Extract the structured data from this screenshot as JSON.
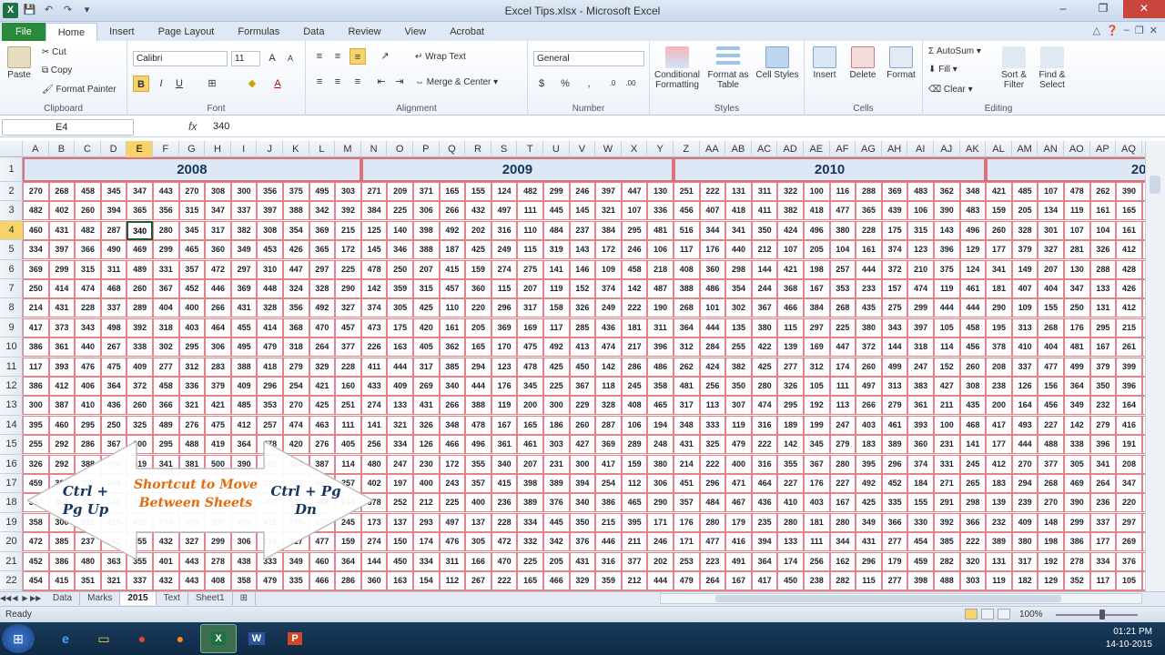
{
  "window": {
    "title": "Excel Tips.xlsx - Microsoft Excel",
    "minimize": "–",
    "restore": "❐",
    "close": "✕"
  },
  "tabs": [
    "File",
    "Home",
    "Insert",
    "Page Layout",
    "Formulas",
    "Data",
    "Review",
    "View",
    "Acrobat"
  ],
  "ribbon": {
    "clipboard": {
      "label": "Clipboard",
      "paste": "Paste",
      "cut": "Cut",
      "copy": "Copy",
      "format_painter": "Format Painter"
    },
    "font": {
      "label": "Font",
      "family": "Calibri",
      "size": "11",
      "bold": "B",
      "italic": "I",
      "underline": "U"
    },
    "alignment": {
      "label": "Alignment",
      "wrap": "Wrap Text",
      "merge": "Merge & Center"
    },
    "number": {
      "label": "Number",
      "format": "General",
      "percent": "%"
    },
    "styles": {
      "label": "Styles",
      "conditional": "Conditional Formatting",
      "format_table": "Format as Table",
      "cell_styles": "Cell Styles"
    },
    "cells": {
      "label": "Cells",
      "insert": "Insert",
      "delete": "Delete",
      "format": "Format"
    },
    "editing": {
      "label": "Editing",
      "autosum": "AutoSum",
      "fill": "Fill",
      "clear": "Clear",
      "sort": "Sort & Filter",
      "find": "Find & Select"
    }
  },
  "formula": {
    "name_box": "E4",
    "fx": "fx",
    "value": "340"
  },
  "columns": [
    "A",
    "B",
    "C",
    "D",
    "E",
    "F",
    "G",
    "H",
    "I",
    "J",
    "K",
    "L",
    "M",
    "N",
    "O",
    "P",
    "Q",
    "R",
    "S",
    "T",
    "U",
    "V",
    "W",
    "X",
    "Y",
    "Z",
    "AA",
    "AB",
    "AC",
    "AD",
    "AE",
    "AF",
    "AG",
    "AH",
    "AI",
    "AJ",
    "AK",
    "AL",
    "AM",
    "AN",
    "AO",
    "AP",
    "AQ",
    "AR"
  ],
  "rows": [
    "1",
    "2",
    "3",
    "4",
    "5",
    "6",
    "7",
    "8",
    "9",
    "10",
    "11",
    "12",
    "13",
    "14",
    "15",
    "16",
    "17",
    "18",
    "19",
    "20",
    "21",
    "22",
    "23"
  ],
  "years": [
    "2008",
    "2009",
    "2010",
    "2011"
  ],
  "table_rows": [
    [
      "270",
      "268",
      "458",
      "345",
      "347",
      "443",
      "270",
      "308",
      "300",
      "356",
      "375",
      "495",
      "303",
      "271",
      "209",
      "371",
      "165",
      "155",
      "124",
      "482",
      "299",
      "246",
      "397",
      "447",
      "130",
      "251",
      "222",
      "131",
      "311",
      "322",
      "100",
      "116",
      "288",
      "369",
      "483",
      "362",
      "348",
      "421",
      "485",
      "107",
      "478",
      "262",
      "390",
      "298"
    ],
    [
      "482",
      "402",
      "260",
      "394",
      "365",
      "356",
      "315",
      "347",
      "337",
      "397",
      "388",
      "342",
      "392",
      "384",
      "225",
      "306",
      "266",
      "432",
      "497",
      "111",
      "445",
      "145",
      "321",
      "107",
      "336",
      "456",
      "407",
      "418",
      "411",
      "382",
      "418",
      "477",
      "365",
      "439",
      "106",
      "390",
      "483",
      "159",
      "205",
      "134",
      "119",
      "161",
      "165",
      "348"
    ],
    [
      "460",
      "431",
      "482",
      "287",
      "340",
      "280",
      "345",
      "317",
      "382",
      "308",
      "354",
      "369",
      "215",
      "125",
      "140",
      "398",
      "492",
      "202",
      "316",
      "110",
      "484",
      "237",
      "384",
      "295",
      "481",
      "516",
      "344",
      "341",
      "350",
      "424",
      "496",
      "380",
      "228",
      "175",
      "315",
      "143",
      "496",
      "260",
      "328",
      "301",
      "107",
      "104",
      "161",
      "166"
    ],
    [
      "334",
      "397",
      "366",
      "490",
      "469",
      "299",
      "465",
      "360",
      "349",
      "453",
      "426",
      "365",
      "172",
      "145",
      "346",
      "388",
      "187",
      "425",
      "249",
      "115",
      "319",
      "143",
      "172",
      "246",
      "106",
      "117",
      "176",
      "440",
      "212",
      "107",
      "205",
      "104",
      "161",
      "374",
      "123",
      "396",
      "129",
      "177",
      "379",
      "327",
      "281",
      "326",
      "412",
      "162"
    ],
    [
      "369",
      "299",
      "315",
      "311",
      "489",
      "331",
      "357",
      "472",
      "297",
      "310",
      "447",
      "297",
      "225",
      "478",
      "250",
      "207",
      "415",
      "159",
      "274",
      "275",
      "141",
      "146",
      "109",
      "458",
      "218",
      "408",
      "360",
      "298",
      "144",
      "421",
      "198",
      "257",
      "444",
      "372",
      "210",
      "375",
      "124",
      "341",
      "149",
      "207",
      "130",
      "288",
      "428",
      "296"
    ],
    [
      "250",
      "414",
      "474",
      "468",
      "260",
      "367",
      "452",
      "446",
      "369",
      "448",
      "324",
      "328",
      "290",
      "142",
      "359",
      "315",
      "457",
      "360",
      "115",
      "207",
      "119",
      "152",
      "374",
      "142",
      "487",
      "388",
      "486",
      "354",
      "244",
      "368",
      "167",
      "353",
      "233",
      "157",
      "474",
      "119",
      "461",
      "181",
      "407",
      "404",
      "347",
      "133",
      "426",
      "104"
    ],
    [
      "214",
      "431",
      "228",
      "337",
      "289",
      "404",
      "400",
      "266",
      "431",
      "328",
      "356",
      "492",
      "327",
      "374",
      "305",
      "425",
      "110",
      "220",
      "296",
      "317",
      "158",
      "326",
      "249",
      "222",
      "190",
      "268",
      "101",
      "302",
      "367",
      "466",
      "384",
      "268",
      "435",
      "275",
      "299",
      "444",
      "444",
      "290",
      "109",
      "155",
      "250",
      "131",
      "412",
      "365"
    ],
    [
      "417",
      "373",
      "343",
      "498",
      "392",
      "318",
      "403",
      "464",
      "455",
      "414",
      "368",
      "470",
      "457",
      "473",
      "175",
      "420",
      "161",
      "205",
      "369",
      "169",
      "117",
      "285",
      "436",
      "181",
      "311",
      "364",
      "444",
      "135",
      "380",
      "115",
      "297",
      "225",
      "380",
      "343",
      "397",
      "105",
      "458",
      "195",
      "313",
      "268",
      "176",
      "295",
      "215",
      "249"
    ],
    [
      "386",
      "361",
      "440",
      "267",
      "338",
      "302",
      "295",
      "306",
      "495",
      "479",
      "318",
      "264",
      "377",
      "226",
      "163",
      "405",
      "362",
      "165",
      "170",
      "475",
      "492",
      "413",
      "474",
      "217",
      "396",
      "312",
      "284",
      "255",
      "422",
      "139",
      "169",
      "447",
      "372",
      "144",
      "318",
      "114",
      "456",
      "378",
      "410",
      "404",
      "481",
      "167",
      "261",
      "156"
    ],
    [
      "117",
      "393",
      "476",
      "475",
      "409",
      "277",
      "312",
      "283",
      "388",
      "418",
      "279",
      "329",
      "228",
      "411",
      "444",
      "317",
      "385",
      "294",
      "123",
      "478",
      "425",
      "450",
      "142",
      "286",
      "486",
      "262",
      "424",
      "382",
      "425",
      "277",
      "312",
      "174",
      "260",
      "499",
      "247",
      "152",
      "260",
      "208",
      "337",
      "477",
      "499",
      "379",
      "399",
      "464"
    ],
    [
      "386",
      "412",
      "406",
      "364",
      "372",
      "458",
      "336",
      "379",
      "409",
      "296",
      "254",
      "421",
      "160",
      "433",
      "409",
      "269",
      "340",
      "444",
      "176",
      "345",
      "225",
      "367",
      "118",
      "245",
      "358",
      "481",
      "256",
      "350",
      "280",
      "326",
      "105",
      "111",
      "497",
      "313",
      "383",
      "427",
      "308",
      "238",
      "126",
      "156",
      "364",
      "350",
      "396",
      "260"
    ],
    [
      "300",
      "387",
      "410",
      "436",
      "260",
      "366",
      "321",
      "421",
      "485",
      "353",
      "270",
      "425",
      "251",
      "274",
      "133",
      "431",
      "266",
      "388",
      "119",
      "200",
      "300",
      "229",
      "328",
      "408",
      "465",
      "317",
      "113",
      "307",
      "474",
      "295",
      "192",
      "113",
      "266",
      "279",
      "361",
      "211",
      "435",
      "200",
      "164",
      "456",
      "349",
      "232",
      "164",
      "372"
    ],
    [
      "395",
      "460",
      "295",
      "250",
      "325",
      "489",
      "276",
      "475",
      "412",
      "257",
      "474",
      "463",
      "111",
      "141",
      "321",
      "326",
      "348",
      "478",
      "167",
      "165",
      "186",
      "260",
      "287",
      "106",
      "194",
      "348",
      "333",
      "119",
      "316",
      "189",
      "199",
      "247",
      "403",
      "461",
      "393",
      "100",
      "468",
      "417",
      "493",
      "227",
      "142",
      "279",
      "416",
      "274"
    ],
    [
      "255",
      "292",
      "286",
      "367",
      "100",
      "295",
      "488",
      "419",
      "364",
      "478",
      "420",
      "276",
      "405",
      "256",
      "334",
      "126",
      "466",
      "496",
      "361",
      "461",
      "303",
      "427",
      "369",
      "289",
      "248",
      "431",
      "325",
      "479",
      "222",
      "142",
      "345",
      "279",
      "183",
      "389",
      "360",
      "231",
      "141",
      "177",
      "444",
      "488",
      "338",
      "396",
      "191",
      "108"
    ],
    [
      "326",
      "292",
      "388",
      "400",
      "419",
      "341",
      "381",
      "500",
      "390",
      "365",
      "384",
      "387",
      "114",
      "480",
      "247",
      "230",
      "172",
      "355",
      "340",
      "207",
      "231",
      "300",
      "417",
      "159",
      "380",
      "214",
      "222",
      "400",
      "316",
      "355",
      "367",
      "280",
      "395",
      "296",
      "374",
      "331",
      "245",
      "412",
      "270",
      "377",
      "305",
      "341",
      "208",
      "277"
    ],
    [
      "459",
      "300",
      "327",
      "264",
      "281",
      "460",
      "301",
      "292",
      "490",
      "370",
      "301",
      "447",
      "257",
      "402",
      "197",
      "400",
      "243",
      "357",
      "415",
      "398",
      "389",
      "394",
      "254",
      "112",
      "306",
      "451",
      "296",
      "471",
      "464",
      "227",
      "176",
      "227",
      "492",
      "452",
      "184",
      "271",
      "265",
      "183",
      "294",
      "268",
      "469",
      "264",
      "347",
      "175"
    ],
    [
      "360",
      "301",
      "323",
      "349",
      "399",
      "394",
      "387",
      "344",
      "403",
      "400",
      "379",
      "466",
      "244",
      "378",
      "252",
      "212",
      "225",
      "400",
      "236",
      "389",
      "376",
      "340",
      "386",
      "465",
      "290",
      "357",
      "484",
      "467",
      "436",
      "410",
      "403",
      "167",
      "425",
      "335",
      "155",
      "291",
      "298",
      "139",
      "239",
      "270",
      "390",
      "236",
      "220",
      "411"
    ],
    [
      "358",
      "300",
      "311",
      "415",
      "425",
      "473",
      "350",
      "305",
      "499",
      "411",
      "375",
      "372",
      "245",
      "173",
      "137",
      "293",
      "497",
      "137",
      "228",
      "334",
      "445",
      "350",
      "215",
      "395",
      "171",
      "176",
      "280",
      "179",
      "235",
      "280",
      "181",
      "280",
      "349",
      "366",
      "330",
      "392",
      "366",
      "232",
      "409",
      "148",
      "299",
      "337",
      "297",
      "417"
    ],
    [
      "472",
      "385",
      "237",
      "352",
      "355",
      "432",
      "327",
      "299",
      "306",
      "319",
      "417",
      "477",
      "159",
      "274",
      "150",
      "174",
      "476",
      "305",
      "472",
      "332",
      "342",
      "376",
      "446",
      "211",
      "246",
      "171",
      "477",
      "416",
      "394",
      "133",
      "111",
      "344",
      "431",
      "277",
      "454",
      "385",
      "222",
      "389",
      "380",
      "198",
      "386",
      "177",
      "269",
      "349"
    ],
    [
      "452",
      "386",
      "480",
      "363",
      "355",
      "401",
      "443",
      "278",
      "438",
      "333",
      "349",
      "460",
      "364",
      "144",
      "450",
      "334",
      "311",
      "166",
      "470",
      "225",
      "205",
      "431",
      "316",
      "377",
      "202",
      "253",
      "223",
      "491",
      "364",
      "174",
      "256",
      "162",
      "296",
      "179",
      "459",
      "282",
      "320",
      "131",
      "317",
      "192",
      "278",
      "334",
      "376",
      "431"
    ],
    [
      "454",
      "415",
      "351",
      "321",
      "337",
      "432",
      "443",
      "408",
      "358",
      "479",
      "335",
      "466",
      "286",
      "360",
      "163",
      "154",
      "112",
      "267",
      "222",
      "165",
      "466",
      "329",
      "359",
      "212",
      "444",
      "479",
      "264",
      "167",
      "417",
      "450",
      "238",
      "282",
      "115",
      "277",
      "398",
      "488",
      "303",
      "119",
      "182",
      "129",
      "352",
      "117",
      "105",
      "100"
    ],
    [
      "497",
      "341",
      "479",
      "311",
      "415",
      "415",
      "351",
      "357",
      "380",
      "359",
      "298",
      "410",
      "281",
      "101",
      "398",
      "210",
      "354",
      "400",
      "397",
      "187",
      "355",
      "409",
      "229",
      "132",
      "276",
      "201",
      "498",
      "423",
      "297",
      "190",
      "232",
      "419",
      "328",
      "186",
      "278",
      "497",
      "346",
      "214",
      "150",
      "387",
      "172",
      "218",
      "232",
      "164"
    ]
  ],
  "active_cell": "E4",
  "overlay": {
    "left": "Ctrl + Pg Up",
    "center": "Shortcut to Move Between Sheets",
    "right": "Ctrl + Pg Dn"
  },
  "sheet_tabs": [
    "Data",
    "Marks",
    "2015",
    "Text",
    "Sheet1"
  ],
  "active_sheet": "2015",
  "status": {
    "ready": "Ready",
    "zoom": "100%"
  },
  "clock": {
    "time": "01:21 PM",
    "date": "14-10-2015"
  },
  "colors": {
    "accent": "#2a8a3c",
    "cell_border": "#e4848a",
    "header_fill": "#dde8f6",
    "selected": "#f6d46a"
  }
}
